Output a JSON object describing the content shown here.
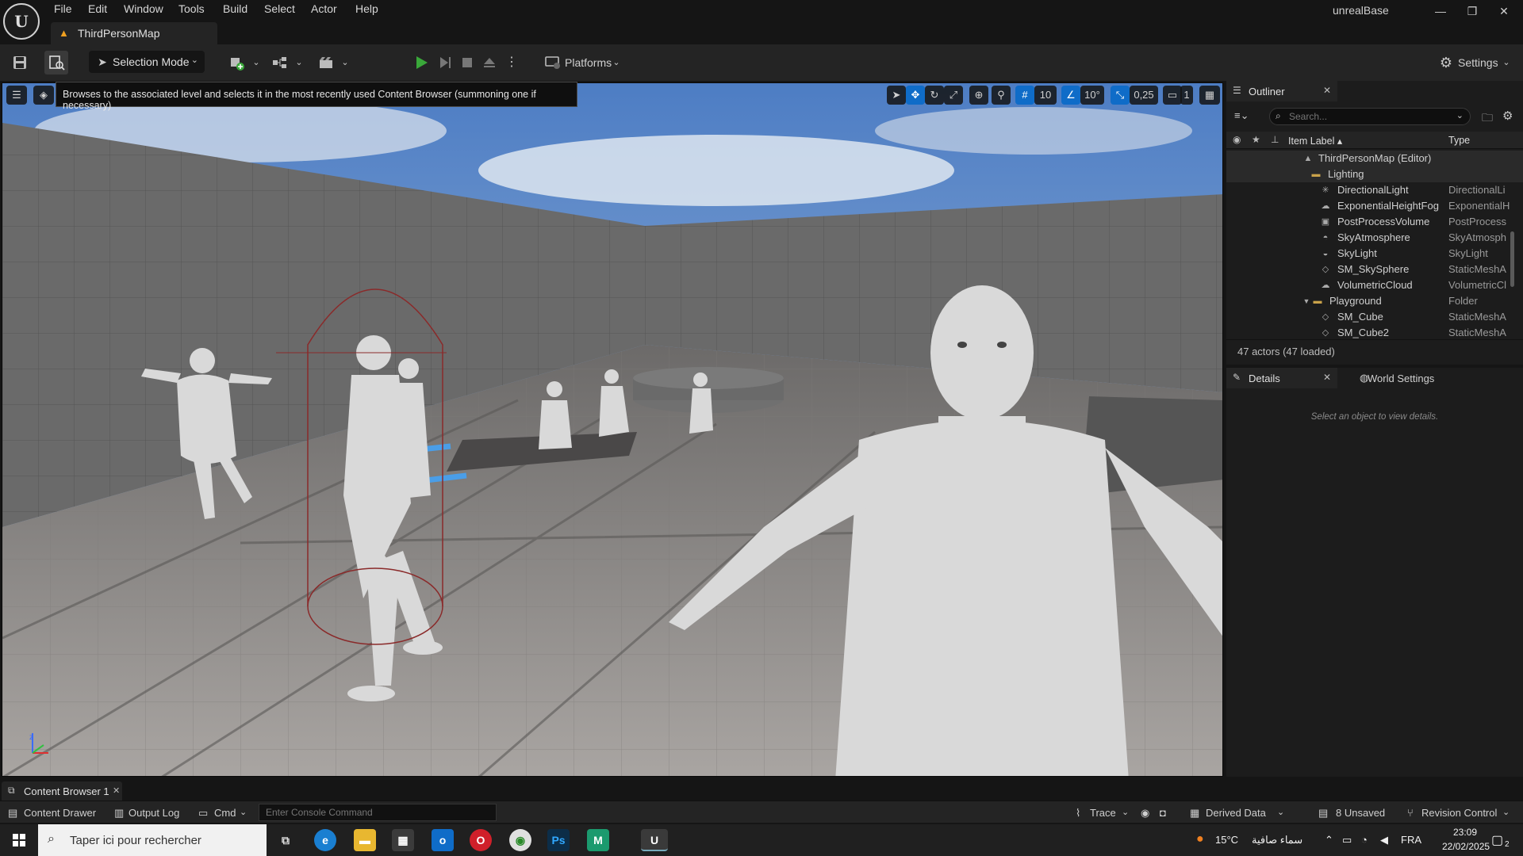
{
  "window": {
    "menu": [
      "File",
      "Edit",
      "Window",
      "Tools",
      "Build",
      "Select",
      "Actor",
      "Help"
    ],
    "project_name": "unrealBase",
    "level_tab": "ThirdPersonMap"
  },
  "toolbar": {
    "selection_mode": "Selection Mode",
    "platforms": "Platforms",
    "settings": "Settings"
  },
  "viewport": {
    "tooltip": "Browses to the associated level and selects it in the most recently used Content Browser (summoning one if necessary)",
    "grid_snap": "10",
    "rotation_snap": "10°",
    "scale_snap": "0,25",
    "camera_speed": "1"
  },
  "outliner": {
    "title": "Outliner",
    "search_placeholder": "Search...",
    "col_label": "Item Label ▴",
    "col_type": "Type",
    "rows": [
      {
        "label": "ThirdPersonMap (Editor)",
        "type": "",
        "icon": "map-icon"
      },
      {
        "label": "Lighting",
        "type": "",
        "icon": "folder-icon"
      },
      {
        "label": "DirectionalLight",
        "type": "DirectionalLi",
        "icon": "sun-icon"
      },
      {
        "label": "ExponentialHeightFog",
        "type": "ExponentialH",
        "icon": "fog-icon"
      },
      {
        "label": "PostProcessVolume",
        "type": "PostProcess",
        "icon": "volume-icon"
      },
      {
        "label": "SkyAtmosphere",
        "type": "SkyAtmosph",
        "icon": "atmosphere-icon"
      },
      {
        "label": "SkyLight",
        "type": "SkyLight",
        "icon": "skylight-icon"
      },
      {
        "label": "SM_SkySphere",
        "type": "StaticMeshA",
        "icon": "mesh-icon"
      },
      {
        "label": "VolumetricCloud",
        "type": "VolumetricCl",
        "icon": "cloud-icon"
      },
      {
        "label": "Playground",
        "type": "Folder",
        "icon": "folder-icon"
      },
      {
        "label": "SM_Cube",
        "type": "StaticMeshA",
        "icon": "mesh-icon"
      },
      {
        "label": "SM_Cube2",
        "type": "StaticMeshA",
        "icon": "mesh-icon"
      }
    ],
    "count": "47 actors (47 loaded)"
  },
  "details": {
    "title": "Details",
    "world_settings": "World Settings",
    "empty_text": "Select an object to view details."
  },
  "bottom": {
    "content_browser_tab": "Content Browser 1",
    "content_drawer": "Content Drawer",
    "output_log": "Output Log",
    "cmd": "Cmd",
    "console_placeholder": "Enter Console Command",
    "trace": "Trace",
    "derived_data": "Derived Data",
    "unsaved": "8 Unsaved",
    "revision_control": "Revision Control"
  },
  "taskbar": {
    "search_placeholder": "Taper ici pour rechercher",
    "weather_temp": "15°C",
    "weather_text": "سماء صافية",
    "language": "FRA",
    "time": "23:09",
    "date": "22/02/2025",
    "notification_count": "2"
  },
  "colors": {
    "accent_blue": "#0f6cc8",
    "play_green": "#3aa83a",
    "panel_bg": "#1c1c1c",
    "toolbar_bg": "#242424"
  }
}
